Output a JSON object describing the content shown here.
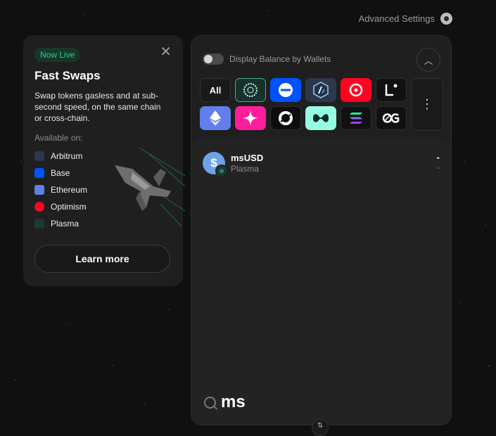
{
  "header": {
    "advanced_settings_label": "Advanced Settings",
    "advanced_settings_icon": "gear-icon"
  },
  "promo": {
    "badge": "Now Live",
    "title": "Fast Swaps",
    "description": "Swap tokens gasless and at sub-second speed, on the same chain or cross-chain.",
    "available_label": "Available on:",
    "chains": [
      {
        "name": "Arbitrum",
        "color": "#2d374b"
      },
      {
        "name": "Base",
        "color": "#0052ff"
      },
      {
        "name": "Ethereum",
        "color": "#627eea"
      },
      {
        "name": "Optimism",
        "color": "#ff0420"
      },
      {
        "name": "Plasma",
        "color": "#1a3a34"
      }
    ],
    "learn_more_label": "Learn more"
  },
  "panel": {
    "display_balance_label": "Display Balance by Wallets",
    "all_label": "All",
    "chain_filters": [
      {
        "icon": "plasma-icon",
        "bg": "#17322c"
      },
      {
        "icon": "base-icon",
        "bg": "#0052ff"
      },
      {
        "icon": "arbitrum-icon",
        "bg": "#2d374b"
      },
      {
        "icon": "optimism-icon",
        "bg": "#ff0420"
      },
      {
        "icon": "linea-icon",
        "bg": "#111111"
      },
      {
        "icon": "ethereum-icon",
        "bg": "#627eea"
      },
      {
        "icon": "blast-icon",
        "bg": "#ff1e9a"
      },
      {
        "icon": "sonic-icon",
        "bg": "#0d0d0d"
      },
      {
        "icon": "hyperliquid-icon",
        "bg": "#97fce4"
      },
      {
        "icon": "solana-icon",
        "bg": "#111111"
      },
      {
        "icon": "og-icon",
        "bg": "#111111"
      }
    ],
    "more_label": "⋮",
    "tokens": [
      {
        "symbol": "msUSD",
        "chain": "Plasma",
        "balance": "-",
        "usd": "-"
      }
    ],
    "search": {
      "value": "ms",
      "placeholder": "Search"
    }
  }
}
